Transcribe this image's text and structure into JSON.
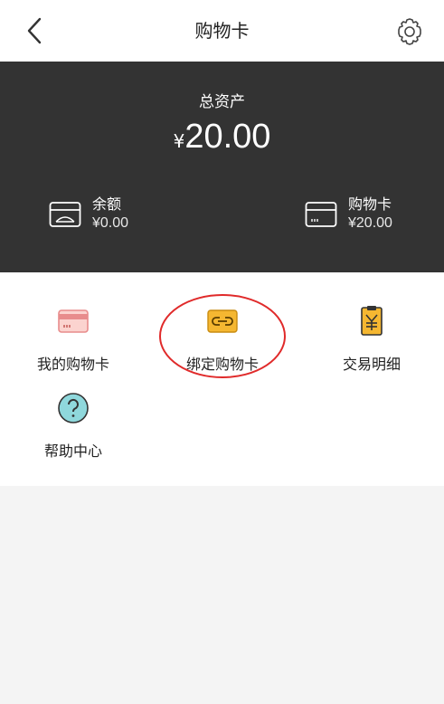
{
  "header": {
    "title": "购物卡",
    "back_icon": "chevron-left-icon",
    "settings_icon": "gear-icon"
  },
  "assets": {
    "label": "总资产",
    "currency_symbol": "¥",
    "total": "20.00",
    "balance": {
      "title": "余额",
      "value": "¥0.00",
      "icon": "wallet-card-icon"
    },
    "shopping_card": {
      "title": "购物卡",
      "value": "¥20.00",
      "icon": "card-icon"
    }
  },
  "menu": {
    "items": [
      {
        "label": "我的购物卡",
        "icon": "pink-card-icon"
      },
      {
        "label": "绑定购物卡",
        "icon": "link-card-icon"
      },
      {
        "label": "交易明细",
        "icon": "yen-receipt-icon"
      },
      {
        "label": "帮助中心",
        "icon": "question-icon"
      }
    ]
  },
  "colors": {
    "dark_panel": "#333333",
    "accent_orange": "#f2a91c",
    "pink": "#f08a8a",
    "teal": "#7fd0d6",
    "highlight_red": "#e02a2a"
  }
}
